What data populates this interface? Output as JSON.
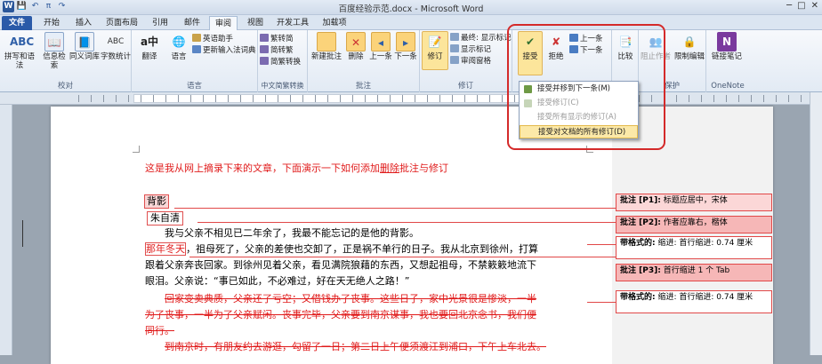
{
  "window": {
    "title": "百度经验示范.docx - Microsoft Word",
    "controls": [
      "─",
      "□",
      "✕"
    ]
  },
  "quick_access": [
    "W",
    "💾",
    "↶",
    "π",
    "↷"
  ],
  "tabs": [
    {
      "label": "文件"
    },
    {
      "label": "开始"
    },
    {
      "label": "插入"
    },
    {
      "label": "页面布局"
    },
    {
      "label": "引用"
    },
    {
      "label": "邮件"
    },
    {
      "label": "审阅"
    },
    {
      "label": "视图"
    },
    {
      "label": "开发工具"
    },
    {
      "label": "加载项"
    }
  ],
  "ribbon": {
    "proofing": {
      "label": "校对",
      "spelling": "拼写和语法",
      "research": "信息检索",
      "thesaurus": "同义词库",
      "wordcount": "字数统计"
    },
    "language": {
      "label": "语言",
      "translate": "翻译",
      "language": "语言",
      "english_assistant": "英语助手",
      "update_ime": "更新输入法词典"
    },
    "chinese": {
      "label": "中文简繁转换",
      "to_simplified": "繁转简",
      "to_traditional": "简转繁",
      "convert": "简繁转换"
    },
    "comments": {
      "label": "批注",
      "new": "新建批注",
      "delete": "删除",
      "previous": "上一条",
      "next": "下一条"
    },
    "tracking": {
      "label": "修订",
      "track": "修订",
      "display": "最终: 显示标记",
      "show_markup": "显示标记",
      "reviewing_pane": "审阅窗格"
    },
    "changes": {
      "accept": "接受",
      "reject": "拒绝",
      "previous": "上一条",
      "next": "下一条"
    },
    "compare": {
      "compare": "比较"
    },
    "protect": {
      "label": "保护",
      "block_authors": "阻止作者",
      "restrict": "限制编辑"
    },
    "onenote": {
      "label": "OneNote",
      "linked_notes": "链接笔记"
    }
  },
  "accept_menu": [
    {
      "label": "接受并移到下一条(M)",
      "enabled": true
    },
    {
      "label": "接受修订(C)",
      "enabled": false
    },
    {
      "label": "接受所有显示的修订(A)",
      "enabled": false
    },
    {
      "label": "接受对文档的所有修订(D)",
      "enabled": true,
      "highlighted": true
    }
  ],
  "document": {
    "intro_plain": "这是我从网上摘录下来的文章，下面演示一下如何添加",
    "intro_ins": "删除",
    "intro_end": "批注与修订",
    "title": "背影",
    "author": "朱自清",
    "p1_line1": "我与父亲不相见已二年余了，我最不能忘记的是他的背影。",
    "p2_red": "那年冬天",
    "p2_line1": "，祖母死了，父亲的差使也交卸了，正是祸不单行的日子。我从北京到徐州，打算",
    "p2_line2": "跟着父亲奔丧回家。到徐州见着父亲，看见满院狼藉的东西，又想起祖母，不禁簌簌地流下",
    "p2_line3": "眼泪。父亲说：“事已如此，不必难过，好在天无绝人之路！”",
    "del_line1": "回家变卖典质，父亲还了亏空；又借钱办了丧事。这些日子，家中光景很是惨淡，一半",
    "del_line2": "为了丧事，一半为了父亲赋闲。丧事完毕，父亲要到南京谋事，我也要回北京念书，我们便",
    "del_line3": "同行。",
    "del_line4": "到南京时，有朋友约去游逛，勾留了一日；第二日上午便须渡江到浦口，下午上车北去。"
  },
  "comments": [
    {
      "label": "批注 [P1]:",
      "text": "标题应居中，宋体"
    },
    {
      "label": "批注 [P2]:",
      "text": "作者应靠右，楷体"
    },
    {
      "label": "带格式的:",
      "text": "缩进: 首行缩进:  0.74 厘米"
    },
    {
      "label": "批注 [P3]:",
      "text": "首行缩进 1 个 Tab"
    },
    {
      "label": "带格式的:",
      "text": "缩进: 首行缩进:  0.74 厘米"
    }
  ]
}
